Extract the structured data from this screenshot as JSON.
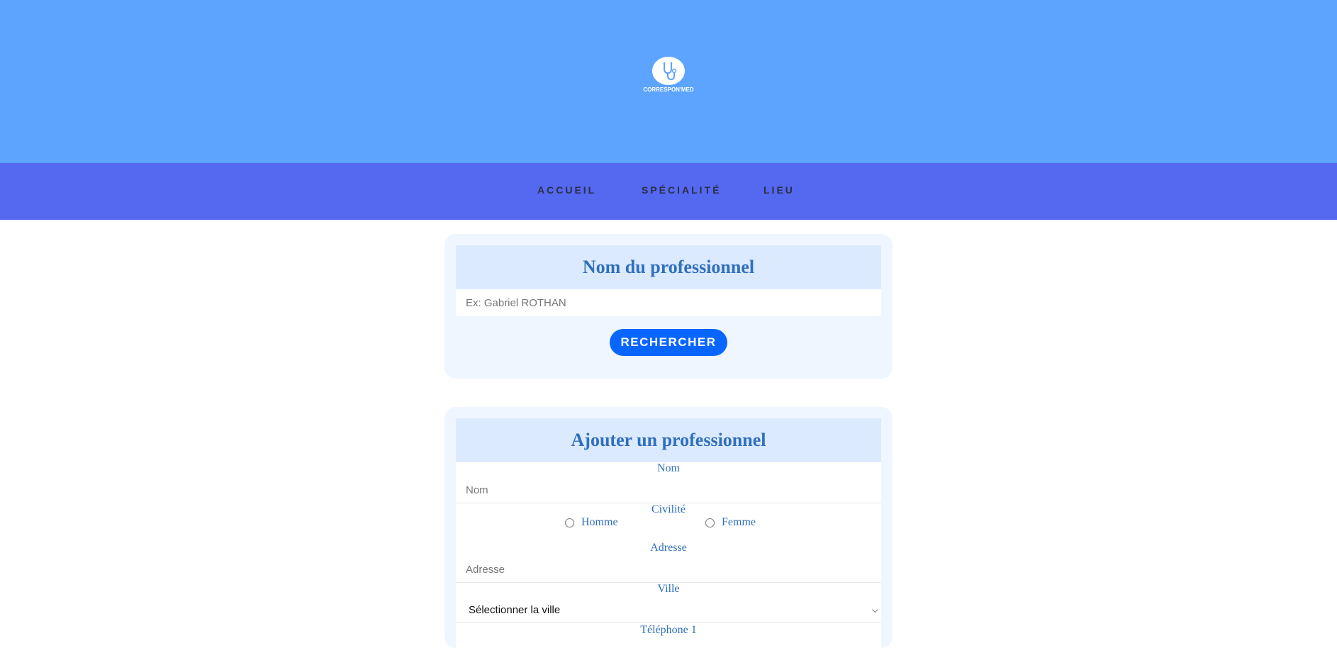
{
  "brand": {
    "logo_text": "CORRESPON'MED"
  },
  "nav": {
    "items": [
      "ACCUEIL",
      "SPÉCIALITÉ",
      "LIEU"
    ]
  },
  "search": {
    "title": "Nom du professionnel",
    "placeholder": "Ex: Gabriel ROTHAN",
    "button": "RECHERCHER"
  },
  "add": {
    "title": "Ajouter un professionnel",
    "nom_label": "Nom",
    "nom_placeholder": "Nom",
    "civilite_label": "Civilité",
    "civilite_options": [
      "Homme",
      "Femme"
    ],
    "adresse_label": "Adresse",
    "adresse_placeholder": "Adresse",
    "ville_label": "Ville",
    "ville_selected": "Sélectionner la ville",
    "telephone_label": "Téléphone 1"
  },
  "colors": {
    "hero": "#5ca4ff",
    "nav": "#5468f0",
    "accent": "#0866ff",
    "heading": "#2f6fbf"
  }
}
